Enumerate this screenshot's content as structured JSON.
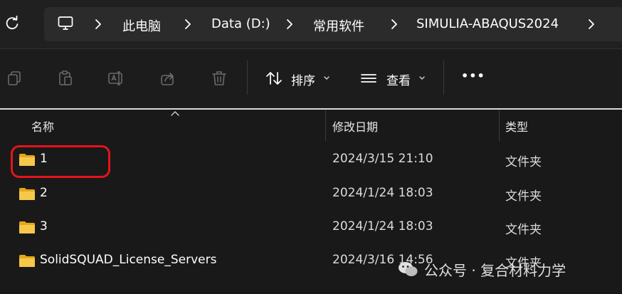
{
  "address_bar": {
    "breadcrumbs": [
      "此电脑",
      "Data (D:)",
      "常用软件",
      "SIMULIA-ABAQUS2024"
    ]
  },
  "toolbar": {
    "sort_label": "排序",
    "view_label": "查看",
    "more_label": "•••"
  },
  "columns": {
    "name": "名称",
    "modified": "修改日期",
    "type": "类型"
  },
  "files": [
    {
      "name": "1",
      "modified": "2024/3/15 21:10",
      "type": "文件夹"
    },
    {
      "name": "2",
      "modified": "2024/1/24 18:03",
      "type": "文件夹"
    },
    {
      "name": "3",
      "modified": "2024/1/24 18:03",
      "type": "文件夹"
    },
    {
      "name": "SolidSQUAD_License_Servers",
      "modified": "2024/3/16 14:56",
      "type": "文件夹"
    }
  ],
  "watermark": {
    "text": "公众号 · 复合材料力学"
  },
  "colors": {
    "highlight": "#e5141b",
    "folder": "#f6c84a"
  }
}
